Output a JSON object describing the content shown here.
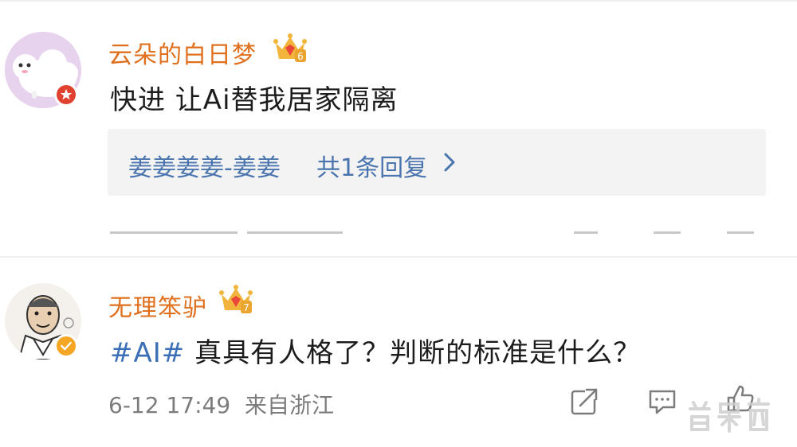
{
  "comments": [
    {
      "username": "云朵的白日梦",
      "level": "6",
      "text": "快进 让Ai替我居家隔离",
      "reply": {
        "name": "姜姜姜姜-姜姜",
        "count_label": "共1条回复"
      }
    },
    {
      "username": "无理笨驴",
      "level": "7",
      "hashtag": "#AI#",
      "text": " 真具有人格了？判断的标准是什么？",
      "timestamp": "6-12 17:49",
      "location": "来自浙江"
    }
  ],
  "icons": {
    "crown": "crown-icon",
    "share": "share-icon",
    "comment": "comment-icon",
    "like": "like-icon",
    "chevron": "chevron-right-icon"
  },
  "colors": {
    "username": "#e0701e",
    "hashtag": "#3b6fb6",
    "reply_link": "#4a74ad",
    "meta": "#7c7c7c",
    "reply_bg": "#f3f3f3"
  }
}
